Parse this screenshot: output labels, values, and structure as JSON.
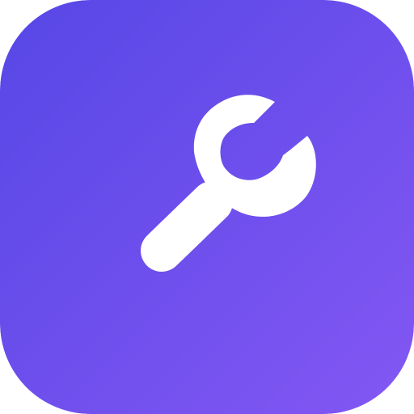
{
  "app_icon": {
    "icon": "wrench-icon",
    "colors": {
      "gradient_start": "#5647E6",
      "gradient_end": "#8457F3",
      "glyph": "#FFFFFF"
    }
  }
}
